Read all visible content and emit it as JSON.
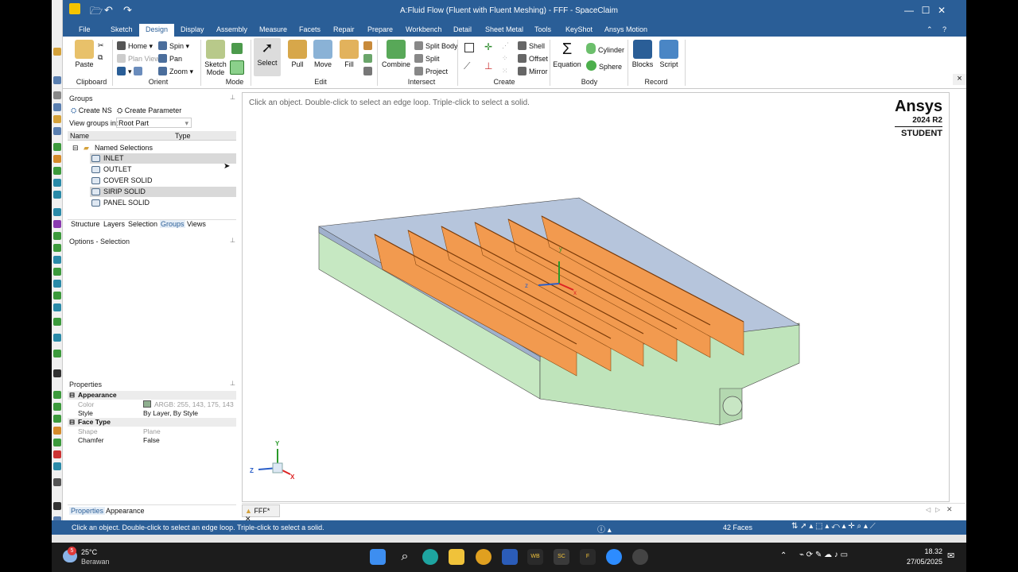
{
  "window": {
    "title": "A:Fluid Flow (Fluent with Fluent Meshing) - FFF - SpaceClaim",
    "minimize": "—",
    "maximize": "☐",
    "close": "✕"
  },
  "ribbon_tabs": [
    "File",
    "Sketch",
    "Design",
    "Display",
    "Assembly",
    "Measure",
    "Facets",
    "Repair",
    "Prepare",
    "Workbench",
    "Detail",
    "Sheet Metal",
    "Tools",
    "KeyShot",
    "Ansys Motion"
  ],
  "active_tab": "Design",
  "ribbon": {
    "clipboard": {
      "group": "Clipboard",
      "paste": "Paste"
    },
    "orient": {
      "group": "Orient",
      "home": "Home",
      "spin": "Spin",
      "plan_view": "Plan View",
      "pan": "Pan",
      "zoom": "Zoom"
    },
    "mode": {
      "group": "Mode",
      "sketch_mode": "Sketch Mode"
    },
    "edit": {
      "group": "Edit",
      "select": "Select",
      "pull": "Pull",
      "move": "Move",
      "fill": "Fill"
    },
    "intersect": {
      "group": "Intersect",
      "combine": "Combine",
      "split_body": "Split Body",
      "split": "Split",
      "project": "Project"
    },
    "create": {
      "group": "Create",
      "shell": "Shell",
      "offset": "Offset",
      "mirror": "Mirror"
    },
    "body": {
      "group": "Body",
      "equation": "Equation",
      "cylinder": "Cylinder",
      "sphere": "Sphere"
    },
    "record": {
      "group": "Record",
      "blocks": "Blocks",
      "script": "Script"
    }
  },
  "groups_panel": {
    "title": "Groups",
    "create_ns": "Create NS",
    "create_parameter": "Create Parameter",
    "view_groups_label": "View groups in:",
    "view_groups_value": "Root Part",
    "col_name": "Name",
    "col_type": "Type",
    "folder": "Named Selections",
    "items": [
      "INLET",
      "OUTLET",
      "COVER SOLID",
      "SIRIP SOLID",
      "PANEL SOLID"
    ],
    "tabs": [
      "Structure",
      "Layers",
      "Selection",
      "Groups",
      "Views"
    ],
    "active_tab": "Groups"
  },
  "options_panel": {
    "title": "Options - Selection"
  },
  "properties": {
    "title": "Properties",
    "appearance_group": "Appearance",
    "color_label": "Color",
    "color_value": "ARGB: 255, 143, 175, 143",
    "color_swatch": "#8faf8f",
    "style_label": "Style",
    "style_value": "By Layer, By Style",
    "face_type_group": "Face Type",
    "shape_label": "Shape",
    "shape_value": "Plane",
    "chamfer_label": "Chamfer",
    "chamfer_value": "False",
    "tabs": [
      "Properties",
      "Appearance"
    ]
  },
  "viewport": {
    "hint": "Click an object. Double-click to select an edge loop. Triple-click to select a solid.",
    "logo_brand": "Ansys",
    "logo_version": "2024 R2",
    "logo_edition": "STUDENT",
    "triad": {
      "x": "x",
      "y": "y",
      "z": "z"
    },
    "triad_main": {
      "x": "X",
      "y": "Y",
      "z": "Z"
    }
  },
  "document_tab": "FFF*",
  "status": {
    "message": "Click an object. Double-click to select an edge loop. Triple-click to select a solid.",
    "face_count": "42 Faces"
  },
  "taskbar": {
    "weather_temp": "25°C",
    "weather_desc": "Berawan",
    "weather_badge": "5",
    "time": "18.32",
    "date": "27/05/2025",
    "app_wb": "WB",
    "app_sc": "SC",
    "app_f": "F"
  }
}
